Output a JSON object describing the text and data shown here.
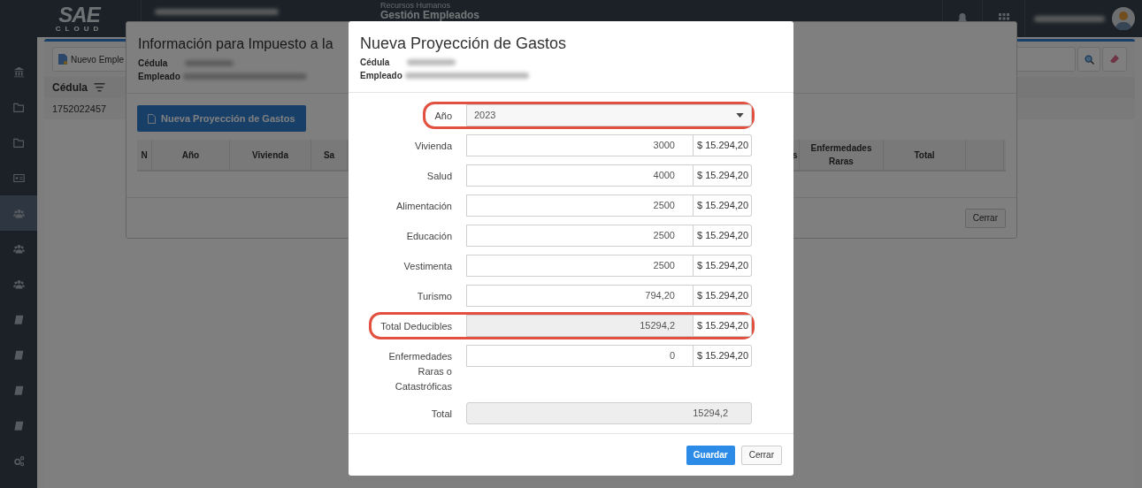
{
  "header": {
    "logo": {
      "word": "SAE",
      "sub": "CLOUD"
    },
    "module": "Recursos Humanos",
    "page": "Gestión Empleados"
  },
  "sidebar": {
    "items": [
      {
        "kind": "bank",
        "selected": false
      },
      {
        "kind": "folder",
        "selected": false
      },
      {
        "kind": "folder",
        "selected": false
      },
      {
        "kind": "card",
        "selected": false
      },
      {
        "kind": "users",
        "selected": true
      },
      {
        "kind": "users",
        "selected": false
      },
      {
        "kind": "users",
        "selected": false
      },
      {
        "kind": "book",
        "selected": false
      },
      {
        "kind": "book",
        "selected": false
      },
      {
        "kind": "book",
        "selected": false
      },
      {
        "kind": "book",
        "selected": false
      },
      {
        "kind": "gears",
        "selected": false
      }
    ]
  },
  "employees": {
    "new_button": "Nuevo Emple",
    "column_1": "Cédula",
    "rows": [
      "1752022457"
    ]
  },
  "tax_info_dialog": {
    "title": "Información para Impuesto a la",
    "cedula_label": "Cédula",
    "employee_label": "Empleado",
    "new_button": "Nueva Proyección de Gastos",
    "columns_left": [
      "N",
      "Año",
      "Vivienda",
      "Sa"
    ],
    "columns_right": [
      "s",
      "Enfermedades Raras",
      "Total"
    ],
    "close_button": "Cerrar"
  },
  "projection_dialog": {
    "title": "Nueva Proyección de Gastos",
    "cedula_label": "Cédula",
    "employee_label": "Empleado",
    "rows": [
      {
        "kind": "select",
        "label": "Año",
        "value": "2023",
        "highlighted": true
      },
      {
        "kind": "input",
        "label": "Vivienda",
        "value": "3000",
        "addon": "$ 15.294,20",
        "highlighted": false
      },
      {
        "kind": "input",
        "label": "Salud",
        "value": "4000",
        "addon": "$ 15.294,20",
        "highlighted": false
      },
      {
        "kind": "input",
        "label": "Alimentación",
        "value": "2500",
        "addon": "$ 15.294,20",
        "highlighted": false
      },
      {
        "kind": "input",
        "label": "Educación",
        "value": "2500",
        "addon": "$ 15.294,20",
        "highlighted": false
      },
      {
        "kind": "input",
        "label": "Vestimenta",
        "value": "2500",
        "addon": "$ 15.294,20",
        "highlighted": false
      },
      {
        "kind": "input",
        "label": "Turismo",
        "value": "794,20",
        "addon": "$ 15.294,20",
        "highlighted": false
      },
      {
        "kind": "readonly",
        "label": "Total Deducibles",
        "value": "15294,2",
        "addon": "$ 15.294,20",
        "highlighted": true
      },
      {
        "kind": "input",
        "label": "Enfermedades Raras o Catastróficas",
        "value": "0",
        "addon": "$ 15.294,20",
        "highlighted": false
      },
      {
        "kind": "readonly",
        "label": "Total",
        "value": "15294,2",
        "highlighted": false
      }
    ],
    "save_button": "Guardar",
    "close_button": "Cerrar"
  }
}
